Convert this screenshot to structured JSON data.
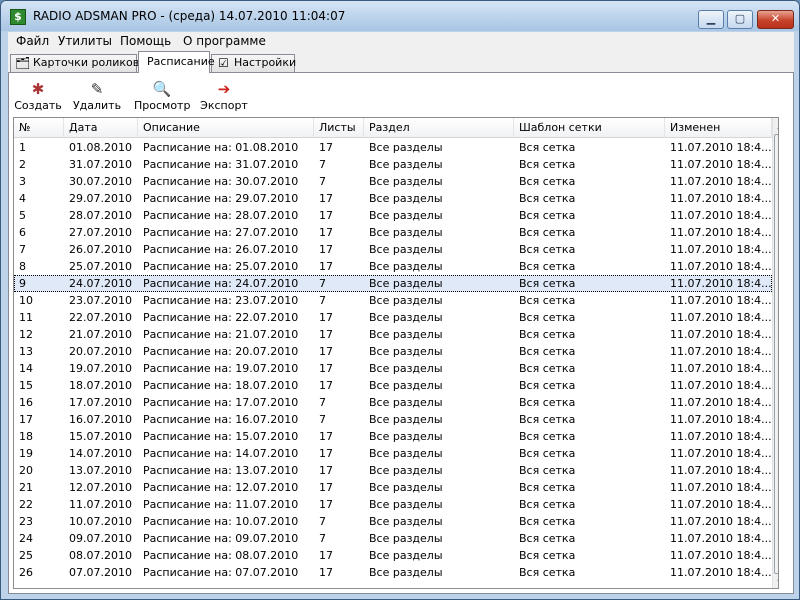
{
  "window": {
    "title": "RADIO ADSMAN PRO - (среда) 14.07.2010 11:04:07",
    "app_icon": "$"
  },
  "menu": [
    "Файл",
    "Утилиты",
    "Помощь",
    "О программе"
  ],
  "tabs": [
    {
      "label": "Карточки роликов",
      "icon": "cards-icon",
      "active": false
    },
    {
      "label": "Расписание",
      "icon": "",
      "active": true
    },
    {
      "label": "Настройки",
      "icon": "settings-checklist-icon",
      "active": false
    }
  ],
  "toolbar": {
    "create": "Создать",
    "delete": "Удалить",
    "preview": "Просмотр",
    "export": "Экспорт"
  },
  "table": {
    "columns": [
      "№",
      "Дата",
      "Описание",
      "Листы",
      "Раздел",
      "Шаблон сетки",
      "Изменен"
    ],
    "selected_row": 8,
    "rows": [
      [
        "1",
        "01.08.2010",
        "Расписание на: 01.08.2010",
        "17",
        "Все разделы",
        "Вся сетка",
        "11.07.2010 18:4..."
      ],
      [
        "2",
        "31.07.2010",
        "Расписание на: 31.07.2010",
        "7",
        "Все разделы",
        "Вся сетка",
        "11.07.2010 18:4..."
      ],
      [
        "3",
        "30.07.2010",
        "Расписание на: 30.07.2010",
        "7",
        "Все разделы",
        "Вся сетка",
        "11.07.2010 18:4..."
      ],
      [
        "4",
        "29.07.2010",
        "Расписание на: 29.07.2010",
        "17",
        "Все разделы",
        "Вся сетка",
        "11.07.2010 18:4..."
      ],
      [
        "5",
        "28.07.2010",
        "Расписание на: 28.07.2010",
        "17",
        "Все разделы",
        "Вся сетка",
        "11.07.2010 18:4..."
      ],
      [
        "6",
        "27.07.2010",
        "Расписание на: 27.07.2010",
        "17",
        "Все разделы",
        "Вся сетка",
        "11.07.2010 18:4..."
      ],
      [
        "7",
        "26.07.2010",
        "Расписание на: 26.07.2010",
        "17",
        "Все разделы",
        "Вся сетка",
        "11.07.2010 18:4..."
      ],
      [
        "8",
        "25.07.2010",
        "Расписание на: 25.07.2010",
        "17",
        "Все разделы",
        "Вся сетка",
        "11.07.2010 18:4..."
      ],
      [
        "9",
        "24.07.2010",
        "Расписание на: 24.07.2010",
        "7",
        "Все разделы",
        "Вся сетка",
        "11.07.2010 18:4..."
      ],
      [
        "10",
        "23.07.2010",
        "Расписание на: 23.07.2010",
        "7",
        "Все разделы",
        "Вся сетка",
        "11.07.2010 18:4..."
      ],
      [
        "11",
        "22.07.2010",
        "Расписание на: 22.07.2010",
        "17",
        "Все разделы",
        "Вся сетка",
        "11.07.2010 18:4..."
      ],
      [
        "12",
        "21.07.2010",
        "Расписание на: 21.07.2010",
        "17",
        "Все разделы",
        "Вся сетка",
        "11.07.2010 18:4..."
      ],
      [
        "13",
        "20.07.2010",
        "Расписание на: 20.07.2010",
        "17",
        "Все разделы",
        "Вся сетка",
        "11.07.2010 18:4..."
      ],
      [
        "14",
        "19.07.2010",
        "Расписание на: 19.07.2010",
        "17",
        "Все разделы",
        "Вся сетка",
        "11.07.2010 18:4..."
      ],
      [
        "15",
        "18.07.2010",
        "Расписание на: 18.07.2010",
        "17",
        "Все разделы",
        "Вся сетка",
        "11.07.2010 18:4..."
      ],
      [
        "16",
        "17.07.2010",
        "Расписание на: 17.07.2010",
        "7",
        "Все разделы",
        "Вся сетка",
        "11.07.2010 18:4..."
      ],
      [
        "17",
        "16.07.2010",
        "Расписание на: 16.07.2010",
        "7",
        "Все разделы",
        "Вся сетка",
        "11.07.2010 18:4..."
      ],
      [
        "18",
        "15.07.2010",
        "Расписание на: 15.07.2010",
        "17",
        "Все разделы",
        "Вся сетка",
        "11.07.2010 18:4..."
      ],
      [
        "19",
        "14.07.2010",
        "Расписание на: 14.07.2010",
        "17",
        "Все разделы",
        "Вся сетка",
        "11.07.2010 18:4..."
      ],
      [
        "20",
        "13.07.2010",
        "Расписание на: 13.07.2010",
        "17",
        "Все разделы",
        "Вся сетка",
        "11.07.2010 18:4..."
      ],
      [
        "21",
        "12.07.2010",
        "Расписание на: 12.07.2010",
        "17",
        "Все разделы",
        "Вся сетка",
        "11.07.2010 18:4..."
      ],
      [
        "22",
        "11.07.2010",
        "Расписание на: 11.07.2010",
        "17",
        "Все разделы",
        "Вся сетка",
        "11.07.2010 18:4..."
      ],
      [
        "23",
        "10.07.2010",
        "Расписание на: 10.07.2010",
        "7",
        "Все разделы",
        "Вся сетка",
        "11.07.2010 18:4..."
      ],
      [
        "24",
        "09.07.2010",
        "Расписание на: 09.07.2010",
        "7",
        "Все разделы",
        "Вся сетка",
        "11.07.2010 18:4..."
      ],
      [
        "25",
        "08.07.2010",
        "Расписание на: 08.07.2010",
        "17",
        "Все разделы",
        "Вся сетка",
        "11.07.2010 18:4..."
      ],
      [
        "26",
        "07.07.2010",
        "Расписание на: 07.07.2010",
        "17",
        "Все разделы",
        "Вся сетка",
        "11.07.2010 18:4..."
      ]
    ]
  }
}
